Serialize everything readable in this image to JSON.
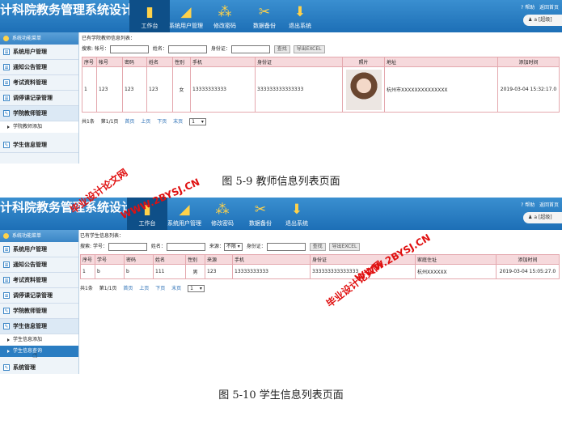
{
  "screen1": {
    "header": {
      "title": "计科院教务管理系统设计与实现",
      "nav": [
        {
          "label": "工作台",
          "icon": "book-icon"
        },
        {
          "label": "系统用户管理",
          "icon": "pencil-ruler-icon"
        },
        {
          "label": "修改密码",
          "icon": "network-icon"
        },
        {
          "label": "数据备份",
          "icon": "tools-icon"
        },
        {
          "label": "退出系统",
          "icon": "download-icon"
        }
      ],
      "help": "帮助",
      "home": "返回首页",
      "user": "a [超级]"
    },
    "sidebar": {
      "menu_title": "系统功能菜单",
      "items": [
        "系统用户管理",
        "通知公告管理",
        "考试资料管理",
        "调停课记录管理",
        "学院教师管理"
      ],
      "subitems": [
        "学院教师添加"
      ],
      "items_after": [
        "学生信息管理"
      ]
    },
    "main": {
      "list_title": "已有学院教师信息列表：",
      "search": {
        "prefix": "搜索:",
        "fields": [
          "帐号：",
          "姓名：",
          "身份证："
        ],
        "query": "查找",
        "export": "导出EXCEL"
      },
      "columns": [
        "序号",
        "帐号",
        "密码",
        "姓名",
        "性别",
        "手机",
        "身份证",
        "照片",
        "地址",
        "添加时间"
      ],
      "rows": [
        [
          "1",
          "123",
          "123",
          "123",
          "女",
          "13333333333",
          "333333333333333",
          "",
          "杭州市XXXXXXXXXXXXXX",
          "2019-03-04 15:32:17.0"
        ]
      ],
      "pager": {
        "total": "共1条",
        "page": "第1/1页",
        "first": "首页",
        "prev": "上页",
        "next": "下页",
        "last": "末页",
        "select": "1"
      }
    }
  },
  "caption1": "图 5-9 教师信息列表页面",
  "screen2": {
    "header": {
      "title": "计科院教务管理系统设计与实现",
      "nav": [
        {
          "label": "工作台",
          "icon": "book-icon"
        },
        {
          "label": "系统用户管理",
          "icon": "pencil-ruler-icon"
        },
        {
          "label": "修改密码",
          "icon": "network-icon"
        },
        {
          "label": "数据备份",
          "icon": "tools-icon"
        },
        {
          "label": "退出系统",
          "icon": "download-icon"
        }
      ],
      "help": "帮助",
      "home": "返回首页",
      "user": "a [超级]"
    },
    "sidebar": {
      "menu_title": "系统功能菜单",
      "items": [
        "系统用户管理",
        "通知公告管理",
        "考试资料管理",
        "调停课记录管理",
        "学院教师管理",
        "学生信息管理"
      ],
      "subitems": [
        "学生信息添加",
        "学生信息查询"
      ],
      "items_after": [
        "系统管理"
      ]
    },
    "main": {
      "list_title": "已有学生信息列表：",
      "search": {
        "prefix": "搜索:",
        "fields": [
          "学号：",
          "姓名：",
          "来源：",
          "身份证："
        ],
        "source_option": "不限",
        "query": "查找",
        "export": "导出EXCEL"
      },
      "columns": [
        "序号",
        "学号",
        "密码",
        "姓名",
        "性别",
        "来源",
        "手机",
        "身份证",
        "家庭住址",
        "添加时间"
      ],
      "rows": [
        [
          "1",
          "b",
          "b",
          "111",
          "男",
          "123",
          "13333333333",
          "333333333333333",
          "杭州XXXXXX",
          "2019-03-04 15:05:27.0"
        ]
      ],
      "pager": {
        "total": "共1条",
        "page": "第1/1页",
        "first": "首页",
        "prev": "上页",
        "next": "下页",
        "last": "末页",
        "select": "1"
      }
    }
  },
  "caption2": "图 5-10 学生信息列表页面",
  "watermarks": [
    {
      "text": "毕业设计论文网"
    },
    {
      "text": "WWW.2BYSJ.CN"
    }
  ],
  "colors": {
    "header": "#2a7dc2",
    "table_header": "#f6d9dc",
    "table_border": "#e4a8ae",
    "watermark": "#e01010"
  }
}
